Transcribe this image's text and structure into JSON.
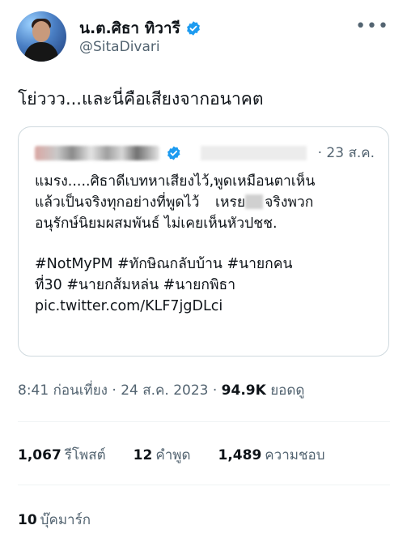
{
  "author": {
    "display_name": "น.ต.ศิธา ทิวารี",
    "handle": "@SitaDivari",
    "verified_icon": "verified-badge-icon",
    "more_icon": "more-options-icon"
  },
  "tweet": {
    "text": "โย่ววว...และนี่คือเสียงจากอนาคต"
  },
  "quoted_tweet": {
    "date": "· 23 ส.ค.",
    "lines": [
      "แมรง.....ศิธาดีเบทหาเสียงไว้,พูดเหมือนตาเห็น",
      "แล้วเป็นจริงทุกอย่างที่พูดไว้",
      "จริงพวก",
      "อนุรักษ์นิยมผสมพันธ์ ไม่เคยเห็นหัวปชช."
    ],
    "partial_word": "เหรย",
    "hashtags_1": "#NotMyPM #ทักษิณกลับบ้าน #นายกคน",
    "hashtags_2": "ที่30 #นายกส้มหล่น #นายกพิธา",
    "link": "pic.twitter.com/KLF7jgDLci"
  },
  "meta": {
    "time_date": "8:41 ก่อนเที่ยง · 24 ส.ค. 2023 · ",
    "views": "94.9K",
    "views_label": "ยอดดู"
  },
  "stats": {
    "retweets": "1,067",
    "retweets_label": "รีโพสต์",
    "quotes": "12",
    "quotes_label": "คำพูด",
    "likes": "1,489",
    "likes_label": "ความชอบ"
  },
  "bookmarks": {
    "count": "10",
    "label": "บุ๊คมาร์ก"
  },
  "colors": {
    "accent": "#1d9bf0",
    "secondary_text": "#536471",
    "border": "#cfd9de"
  }
}
